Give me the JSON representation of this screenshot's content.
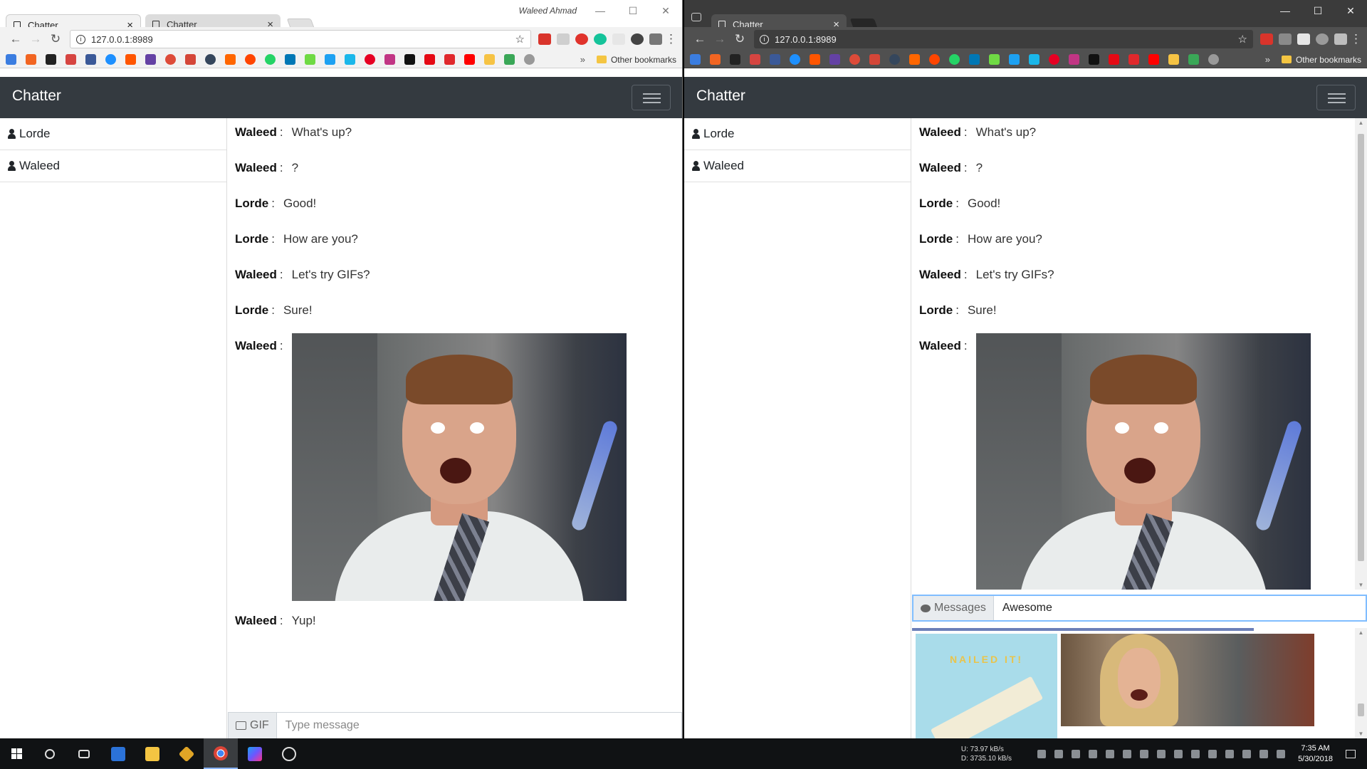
{
  "os": {
    "profile_name": "Waleed Ahmad",
    "taskbar": {
      "net_up": "U:      73.97 kB/s",
      "net_down": "D:  3735.10 kB/s",
      "time": "7:35 AM",
      "date": "5/30/2018"
    }
  },
  "left_window": {
    "tabs": [
      {
        "label": "Chatter",
        "active": true
      },
      {
        "label": "Chatter",
        "active": false
      }
    ],
    "address": "127.0.0.1:8989",
    "other_bookmarks": "Other bookmarks",
    "bookmarks_more": "»"
  },
  "right_window": {
    "tabs": [
      {
        "label": "Chatter",
        "active": true
      }
    ],
    "address": "127.0.0.1:8989",
    "other_bookmarks": "Other bookmarks",
    "bookmarks_more": "»"
  },
  "app": {
    "brand": "Chatter",
    "users": [
      "Lorde",
      "Waleed"
    ],
    "separator": ":",
    "messages": [
      {
        "author": "Waleed",
        "text": "What's up?"
      },
      {
        "author": "Waleed",
        "text": "?"
      },
      {
        "author": "Lorde",
        "text": "Good!"
      },
      {
        "author": "Lorde",
        "text": "How are you?"
      },
      {
        "author": "Waleed",
        "text": "Let's try GIFs?"
      },
      {
        "author": "Lorde",
        "text": "Sure!"
      },
      {
        "author": "Waleed",
        "text": ""
      },
      {
        "author": "Waleed",
        "text": "Yup!"
      }
    ],
    "left_composer": {
      "addon_label": "GIF",
      "placeholder": "Type message",
      "value": ""
    },
    "right_composer": {
      "addon_label": "Messages",
      "placeholder": "",
      "value": "Awesome"
    },
    "gif_results": [
      {
        "caption": "NAILED IT!"
      }
    ]
  },
  "colors": {
    "navbar": "#343a40",
    "focus_border": "#80bdff",
    "left_chrome": "#f2f2f2",
    "right_chrome": "#505050"
  }
}
